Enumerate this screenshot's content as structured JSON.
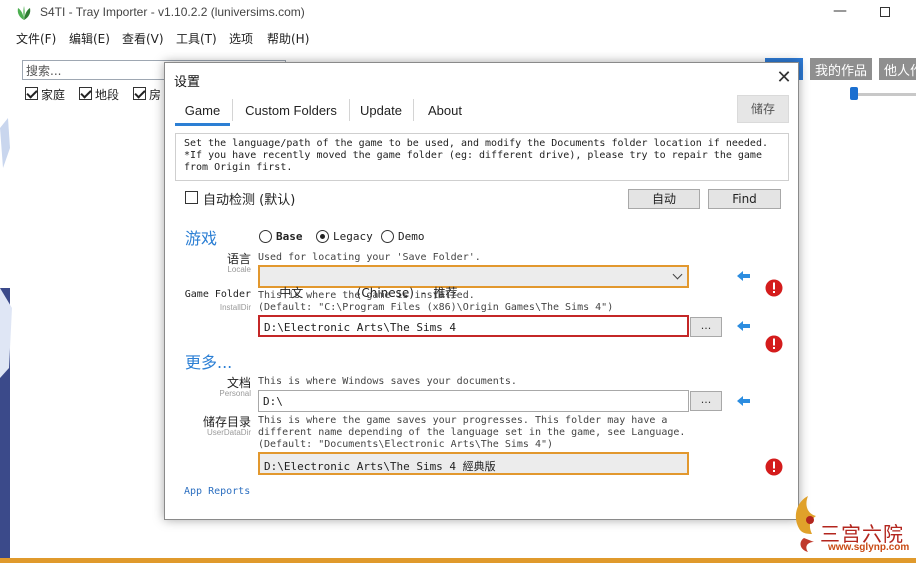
{
  "app": {
    "title": "S4TI - Tray Importer - v1.10.2.2  (luniversims.com)",
    "menu": [
      "文件(F)",
      "编辑(E)",
      "查看(V)",
      "工具(T)",
      "选项",
      "帮助(H)"
    ],
    "search_placeholder": "搜索...",
    "filters": [
      "家庭",
      "地段",
      "房"
    ],
    "top_buttons": [
      "我的作品",
      "他人作"
    ]
  },
  "dialog": {
    "title": "设置",
    "tabs": [
      "Game",
      "Custom Folders",
      "Update",
      "About"
    ],
    "save_label": "储存",
    "description": "Set the language/path of the game to be used, and modify the Documents folder location if needed.\n*If you have recently moved the game folder (eg: different drive), please try to repair the game\nfrom Origin first.",
    "autodetect_label": "自动检测 (默认)",
    "auto_button": "自动",
    "find_button": "Find",
    "game_section": "游戏",
    "version_options": [
      "Base",
      "Legacy",
      "Demo"
    ],
    "selected_version": "Legacy",
    "language": {
      "label": "语言",
      "sublabel": "Locale",
      "hint": "Used for locating your 'Save Folder'.",
      "value": "中文              (Chinese)  -  推荐"
    },
    "game_folder": {
      "label": "Game Folder",
      "sublabel": "InstallDir",
      "hint": "This is where the game is installed.\n(Default: \"C:\\Program Files (x86)\\Origin Games\\The Sims 4\")",
      "value": "D:\\Electronic Arts\\The Sims 4"
    },
    "more_section": "更多...",
    "documents": {
      "label": "文档",
      "sublabel": "Personal",
      "hint": "This is where Windows saves your documents.",
      "value": "D:\\"
    },
    "user_data": {
      "label": "储存目录",
      "sublabel": "UserDataDir",
      "hint": "This is where the game saves your progresses. This folder may have a\ndifferent name depending of the language set in the game, see Language.\n(Default: \"Documents\\Electronic Arts\\The Sims 4\")",
      "value": "D:\\Electronic Arts\\The Sims 4 經典版"
    },
    "browse_label": "...",
    "app_reports": "App Reports"
  },
  "watermark": {
    "text": "三宫六院",
    "url": "www.sglynp.com"
  },
  "colors": {
    "accent": "#2c7fd4",
    "highlight_border": "#e2982e",
    "error_border": "#c42727",
    "warning": "#d41c1c"
  }
}
